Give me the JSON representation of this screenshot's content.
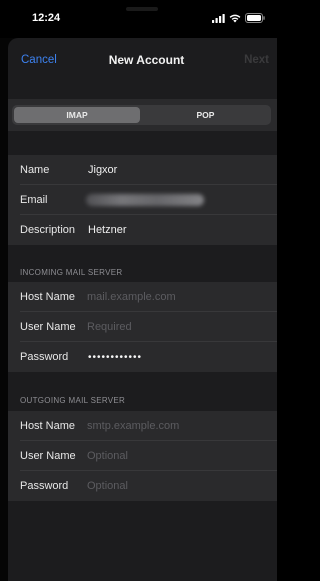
{
  "status_bar": {
    "time": "12:24"
  },
  "nav": {
    "cancel_label": "Cancel",
    "title": "New Account",
    "next_label": "Next"
  },
  "account_type": {
    "options": [
      "IMAP",
      "POP"
    ],
    "selected": "IMAP"
  },
  "account_info": {
    "name": {
      "label": "Name",
      "value": "Jigxor"
    },
    "email": {
      "label": "Email",
      "value": ""
    },
    "description": {
      "label": "Description",
      "value": "Hetzner"
    }
  },
  "incoming": {
    "header": "INCOMING MAIL SERVER",
    "host": {
      "label": "Host Name",
      "placeholder": "mail.example.com"
    },
    "user": {
      "label": "User Name",
      "placeholder": "Required"
    },
    "password": {
      "label": "Password",
      "value": "••••••••••••"
    }
  },
  "outgoing": {
    "header": "OUTGOING MAIL SERVER",
    "host": {
      "label": "Host Name",
      "placeholder": "smtp.example.com"
    },
    "user": {
      "label": "User Name",
      "placeholder": "Optional"
    },
    "password": {
      "label": "Password",
      "placeholder": "Optional"
    }
  },
  "colors": {
    "accent": "#3d82f0",
    "background": "#1c1c1e",
    "group": "#2a2a2c"
  }
}
